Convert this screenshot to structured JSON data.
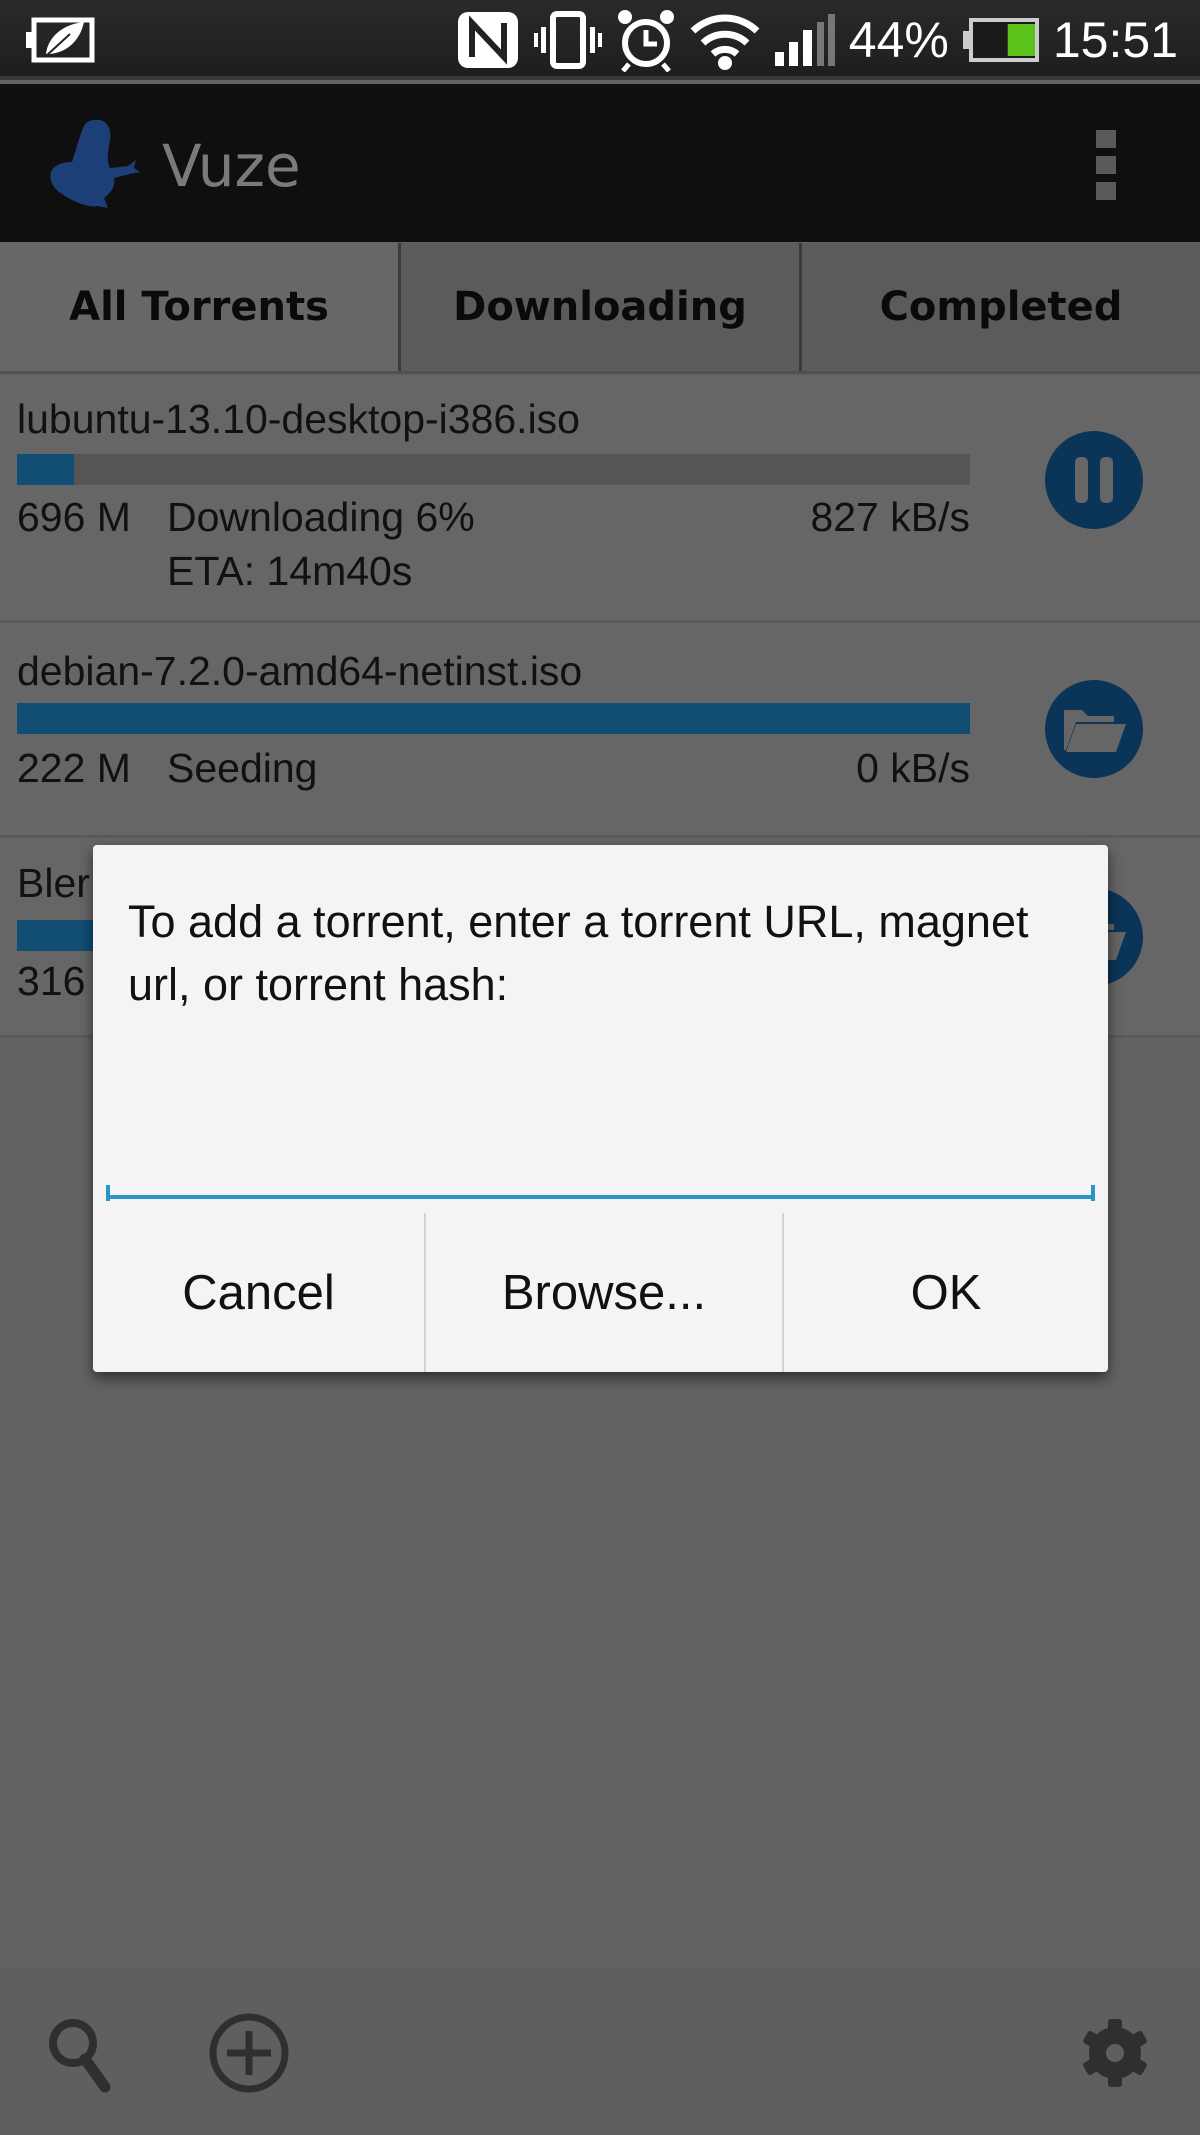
{
  "status_bar": {
    "battery_percent_label": "44%",
    "battery_level": 0.44,
    "time": "15:51",
    "icons": [
      "power-saver-icon",
      "nfc-icon",
      "vibrate-icon",
      "alarm-icon",
      "wifi-icon",
      "signal-icon",
      "battery-icon"
    ]
  },
  "action_bar": {
    "title": "Vuze",
    "logo_icon": "vuze-frog-logo",
    "overflow_icon": "overflow-menu-icon"
  },
  "tabs": [
    {
      "label": "All Torrents",
      "selected": true
    },
    {
      "label": "Downloading",
      "selected": false
    },
    {
      "label": "Completed",
      "selected": false
    }
  ],
  "torrents": [
    {
      "name": "lubuntu-13.10-desktop-i386.iso",
      "progress": 0.06,
      "size": "696 M",
      "status": "Downloading 6%",
      "eta": "ETA: 14m40s",
      "speed": "827 kB/s",
      "action_icon": "pause-icon"
    },
    {
      "name": "debian-7.2.0-amd64-netinst.iso",
      "progress": 1.0,
      "size": "222 M",
      "status": "Seeding",
      "speed": "0 kB/s",
      "action_icon": "folder-icon"
    },
    {
      "name": "Bler",
      "progress": 1.0,
      "size": "316",
      "action_icon": "folder-icon"
    }
  ],
  "dialog": {
    "message": "To add a torrent, enter a torrent URL, magnet url, or torrent hash:",
    "input_value": "",
    "input_placeholder": "",
    "buttons": {
      "cancel": "Cancel",
      "browse": "Browse...",
      "ok": "OK"
    }
  },
  "bottom_bar": {
    "icons": [
      "search-icon",
      "add-icon",
      "settings-icon"
    ]
  },
  "colors": {
    "accent": "#2a95c9",
    "progress_fill": "#124d74",
    "action_circle": "#0b3558",
    "battery_green": "#5bc21a"
  }
}
